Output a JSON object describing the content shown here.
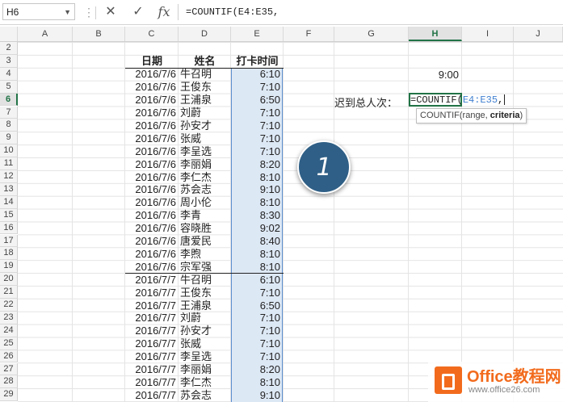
{
  "formula_bar": {
    "name_box": "H6",
    "formula": "=COUNTIF(E4:E35,"
  },
  "columns": [
    "A",
    "B",
    "C",
    "D",
    "E",
    "F",
    "G",
    "H",
    "I",
    "J"
  ],
  "active_column": "H",
  "active_row": "6",
  "rows": [
    "2",
    "3",
    "4",
    "5",
    "6",
    "7",
    "8",
    "9",
    "10",
    "11",
    "12",
    "13",
    "14",
    "15",
    "16",
    "17",
    "18",
    "19",
    "20",
    "21",
    "22",
    "23",
    "24",
    "25",
    "26",
    "27",
    "28",
    "29"
  ],
  "table": {
    "headers": {
      "date": "日期",
      "name": "姓名",
      "time": "打卡时间"
    },
    "records": [
      {
        "date": "2016/7/6",
        "name": "牛召明",
        "time": "6:10"
      },
      {
        "date": "2016/7/6",
        "name": "王俊东",
        "time": "7:10"
      },
      {
        "date": "2016/7/6",
        "name": "王浦泉",
        "time": "6:50"
      },
      {
        "date": "2016/7/6",
        "name": "刘蔚",
        "time": "7:10"
      },
      {
        "date": "2016/7/6",
        "name": "孙安才",
        "time": "7:10"
      },
      {
        "date": "2016/7/6",
        "name": "张威",
        "time": "7:10"
      },
      {
        "date": "2016/7/6",
        "name": "李呈选",
        "time": "7:10"
      },
      {
        "date": "2016/7/6",
        "name": "李丽娟",
        "time": "8:20"
      },
      {
        "date": "2016/7/6",
        "name": "李仁杰",
        "time": "8:10"
      },
      {
        "date": "2016/7/6",
        "name": "苏会志",
        "time": "9:10"
      },
      {
        "date": "2016/7/6",
        "name": "周小伦",
        "time": "8:10"
      },
      {
        "date": "2016/7/6",
        "name": "李青",
        "time": "8:30"
      },
      {
        "date": "2016/7/6",
        "name": "容晓胜",
        "time": "9:02"
      },
      {
        "date": "2016/7/6",
        "name": "唐爱民",
        "time": "8:40"
      },
      {
        "date": "2016/7/6",
        "name": "李煦",
        "time": "8:10"
      },
      {
        "date": "2016/7/6",
        "name": "宗军强",
        "time": "8:10"
      },
      {
        "date": "2016/7/7",
        "name": "牛召明",
        "time": "6:10"
      },
      {
        "date": "2016/7/7",
        "name": "王俊东",
        "time": "7:10"
      },
      {
        "date": "2016/7/7",
        "name": "王浦泉",
        "time": "6:50"
      },
      {
        "date": "2016/7/7",
        "name": "刘蔚",
        "time": "7:10"
      },
      {
        "date": "2016/7/7",
        "name": "孙安才",
        "time": "7:10"
      },
      {
        "date": "2016/7/7",
        "name": "张威",
        "time": "7:10"
      },
      {
        "date": "2016/7/7",
        "name": "李呈选",
        "time": "7:10"
      },
      {
        "date": "2016/7/7",
        "name": "李丽娟",
        "time": "8:20"
      },
      {
        "date": "2016/7/7",
        "name": "李仁杰",
        "time": "8:10"
      },
      {
        "date": "2016/7/7",
        "name": "苏会志",
        "time": "9:10"
      }
    ]
  },
  "h4_value": "9:00",
  "g6_label": "迟到总人次：",
  "editing": {
    "prefix": "=COUNTIF(",
    "ref": "E4:E35",
    "suffix": ","
  },
  "tooltip": {
    "func": "COUNTIF(range, ",
    "bold_arg": "criteria",
    "close": ")"
  },
  "step_badge": "1",
  "watermark": {
    "title": "Office教程网",
    "url": "www.office26.com"
  },
  "colors": {
    "accent": "#217346",
    "badge": "#2f5f86",
    "selection": "#dde8f5",
    "brand": "#f26b1d"
  }
}
